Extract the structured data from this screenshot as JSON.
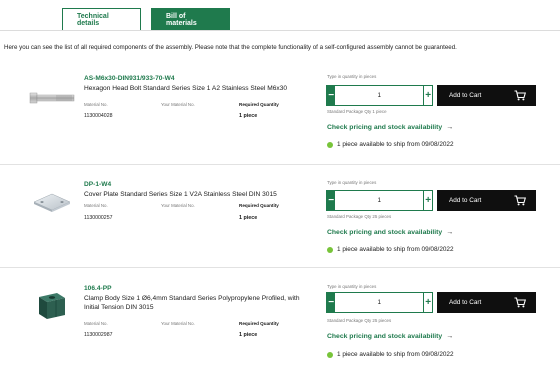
{
  "tabs": [
    {
      "label": "Technical details",
      "active": false
    },
    {
      "label": "Bill of materials",
      "active": true
    }
  ],
  "intro": "Here you can see the list of all required components of the assembly. Please note that the complete functionality of a self-configured assembly cannot be guaranteed.",
  "labels": {
    "material_no": "Material No.",
    "your_material_no": "Your Material No.",
    "required_quantity": "Required Quantity",
    "type_in_quantity": "Type in quantity in pieces",
    "add_to_cart": "Add to Cart",
    "check_pricing": "Check pricing and stock availability",
    "minus": "−",
    "plus": "+",
    "arrow": "→"
  },
  "items": [
    {
      "code": "AS-M6x30-DIN931/933-70-W4",
      "title": "Hexagon Head Bolt Standard Series Size 1 A2 Stainless Steel M6x30",
      "material_no": "1130004028",
      "required_quantity": "1 piece",
      "quantity": "1",
      "package_qty": "Standard Package Qty 1 piece",
      "availability": "1 piece available to ship from 09/08/2022",
      "image_icon": "bolt-image"
    },
    {
      "code": "DP-1-W4",
      "title": "Cover Plate Standard Series Size 1 V2A Stainless Steel DIN 3015",
      "material_no": "1130000257",
      "required_quantity": "1 piece",
      "quantity": "1",
      "package_qty": "Standard Package Qty 25 pieces",
      "availability": "1 piece available to ship from 09/08/2022",
      "image_icon": "cover-plate-image"
    },
    {
      "code": "106.4-PP",
      "title": "Clamp Body Size 1 Ø6,4mm Standard Series Polypropylene Profiled, with Initial Tension DIN 3015",
      "material_no": "1130002987",
      "required_quantity": "1 piece",
      "quantity": "1",
      "package_qty": "Standard Package Qty 25 pieces",
      "availability": "1 piece available to ship from 09/08/2022",
      "image_icon": "clamp-body-image"
    }
  ],
  "colors": {
    "accent": "#1f7a4d",
    "cart_button": "#0f0f0f",
    "availability_dot": "#78c43a"
  }
}
